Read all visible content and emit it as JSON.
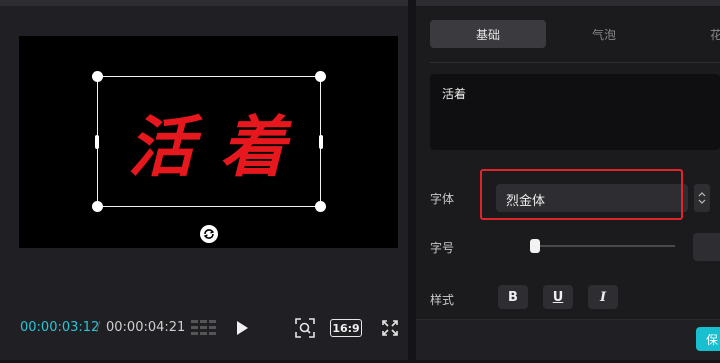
{
  "player": {
    "overlay_text": "活着",
    "current_time": "00:00:03:12",
    "time_separator": "/",
    "total_time": "00:00:04:21",
    "aspect_ratio": "16:9"
  },
  "props": {
    "tabs": [
      {
        "label": "基础",
        "active": true
      },
      {
        "label": "气泡",
        "active": false
      },
      {
        "label": "花",
        "active": false
      }
    ],
    "text_content": "活着",
    "font_label": "字体",
    "font_value": "烈金体",
    "size_label": "字号",
    "size_slider_fraction": 0.03,
    "style_label": "样式",
    "style_buttons": [
      "B",
      "U",
      "I"
    ],
    "save_label": "保"
  },
  "colors": {
    "accent": "#29c4d6",
    "overlay_text": "#e6181d",
    "highlight": "#e0252a",
    "save": "#18bfcf"
  }
}
